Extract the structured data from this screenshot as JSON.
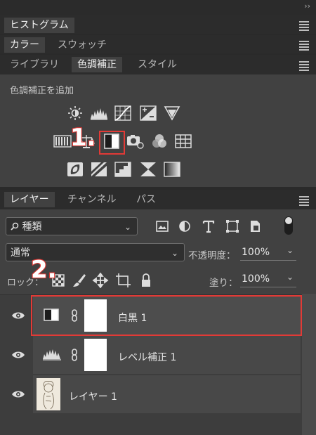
{
  "top_strip": {
    "collapse_glyph": "››"
  },
  "histogram_tab": {
    "label": "ヒストグラム"
  },
  "color_tabs": [
    "カラー",
    "スウォッチ"
  ],
  "adj_tabs": [
    "ライブラリ",
    "色調補正",
    "スタイル"
  ],
  "adjustments": {
    "heading": "色調補正を追加",
    "row1": [
      "brightness-contrast-icon",
      "levels-icon",
      "curves-icon",
      "exposure-icon",
      "vibrance-icon"
    ],
    "row2": [
      "hue-saturation-icon",
      "color-balance-icon",
      "black-white-icon",
      "photo-filter-icon",
      "channel-mixer-icon",
      "color-lookup-icon"
    ],
    "row3": [
      "invert-icon",
      "posterize-icon",
      "threshold-icon",
      "selective-color-icon",
      "gradient-map-icon"
    ],
    "marker1": "1.",
    "marker2": "2."
  },
  "layer_tabs": [
    "レイヤー",
    "チャンネル",
    "パス"
  ],
  "filter": {
    "kind_value": "種類",
    "chevron": "⌄"
  },
  "blend": {
    "mode": "通常",
    "opacity_label": "不透明度：",
    "opacity_value": "100%",
    "lock_label": "ロック：",
    "fill_label": "塗り：",
    "fill_value": "100%"
  },
  "layers": [
    {
      "name": "白黒 1"
    },
    {
      "name": "レベル補正 1"
    },
    {
      "name": "レイヤー 1"
    }
  ],
  "colors": {
    "accent": "#e23a36",
    "panel": "#414141",
    "selected_layer": "#4a4a4a"
  }
}
